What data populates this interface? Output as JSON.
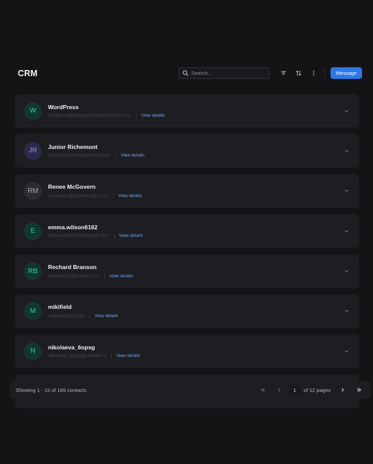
{
  "app": {
    "title": "CRM"
  },
  "toolbar": {
    "search_placeholder": "Search...",
    "filter_icon": "filter-icon",
    "sort_icon": "sort-icon",
    "more_icon": "more-vertical-icon",
    "message_label": "Message"
  },
  "colors": {
    "background": "#141416",
    "card": "#1e1e22",
    "accent": "#2a77e8",
    "link": "#6aa5f5"
  },
  "contacts": [
    {
      "initials": "W",
      "name": "WordPress",
      "email": "wordpress@staging.woodlandsranch.com",
      "action": "View details",
      "avatar_bg": "#13362e",
      "avatar_fg": "#3ccf99"
    },
    {
      "initials": "JR",
      "name": "Junior Richemont",
      "email": "junior@smartfunyleadsfast.com",
      "action": "View details",
      "avatar_bg": "#2a2a4a",
      "avatar_fg": "#9a93f0"
    },
    {
      "initials": "RM",
      "name": "Renee McGovern",
      "email": "rmcgovern@southernagri.com",
      "action": "View details",
      "avatar_bg": "#2c2c31",
      "avatar_fg": "#a6a6ae"
    },
    {
      "initials": "E",
      "name": "emma.wilson6162",
      "email": "emma.wilson6162@gmail.com",
      "action": "View details",
      "avatar_bg": "#13362e",
      "avatar_fg": "#3ccf99"
    },
    {
      "initials": "RB",
      "name": "Rechard Branson",
      "email": "rechard612@hotmail.com",
      "action": "View details",
      "avatar_bg": "#13362e",
      "avatar_fg": "#3ccf99"
    },
    {
      "initials": "M",
      "name": "mikifield",
      "email": "mikifield@aol.com",
      "action": "View details",
      "avatar_bg": "#13362e",
      "avatar_fg": "#3ccf99"
    },
    {
      "initials": "N",
      "name": "nikolaeva_6opsg",
      "email": "nikolaeva_6opsg@rambler.ru",
      "action": "View details",
      "avatar_bg": "#13362e",
      "avatar_fg": "#3ccf99"
    }
  ],
  "pagination": {
    "summary": "Showing 1 - 15 of 169 contacts",
    "current_page": "1",
    "of_pages": "of 12 pages"
  }
}
